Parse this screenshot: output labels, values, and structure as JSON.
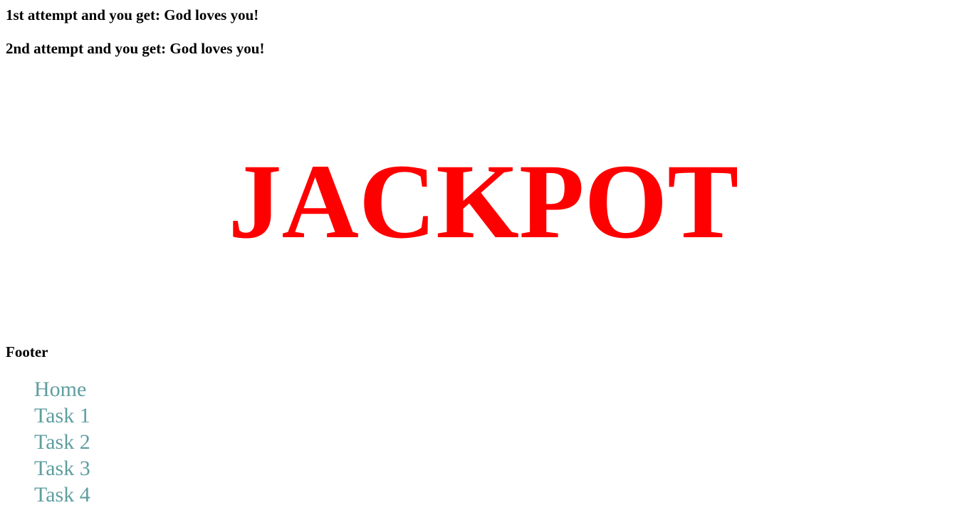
{
  "attempts": [
    {
      "label": "1st attempt and you get: God loves you!"
    },
    {
      "label": "2nd attempt and you get: God loves you!"
    }
  ],
  "jackpot": {
    "text": "JACKPOT",
    "color": "#ff0000"
  },
  "footer": {
    "title": "Footer",
    "link_color": "#5f9ea0",
    "links": [
      {
        "label": "Home"
      },
      {
        "label": "Task 1"
      },
      {
        "label": "Task 2"
      },
      {
        "label": "Task 3"
      },
      {
        "label": "Task 4"
      }
    ]
  }
}
